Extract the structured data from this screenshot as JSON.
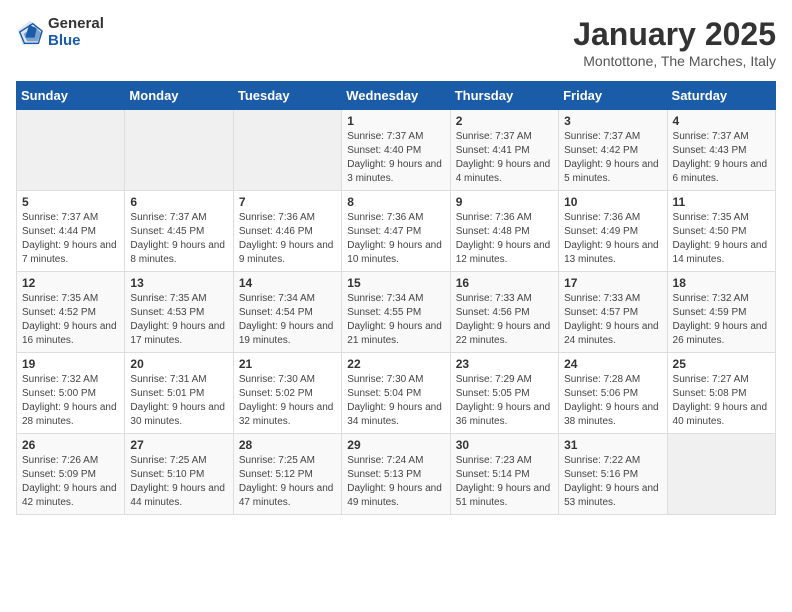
{
  "header": {
    "logo_general": "General",
    "logo_blue": "Blue",
    "month_title": "January 2025",
    "subtitle": "Montottone, The Marches, Italy"
  },
  "weekdays": [
    "Sunday",
    "Monday",
    "Tuesday",
    "Wednesday",
    "Thursday",
    "Friday",
    "Saturday"
  ],
  "weeks": [
    [
      {
        "day": "",
        "info": ""
      },
      {
        "day": "",
        "info": ""
      },
      {
        "day": "",
        "info": ""
      },
      {
        "day": "1",
        "info": "Sunrise: 7:37 AM\nSunset: 4:40 PM\nDaylight: 9 hours and 3 minutes."
      },
      {
        "day": "2",
        "info": "Sunrise: 7:37 AM\nSunset: 4:41 PM\nDaylight: 9 hours and 4 minutes."
      },
      {
        "day": "3",
        "info": "Sunrise: 7:37 AM\nSunset: 4:42 PM\nDaylight: 9 hours and 5 minutes."
      },
      {
        "day": "4",
        "info": "Sunrise: 7:37 AM\nSunset: 4:43 PM\nDaylight: 9 hours and 6 minutes."
      }
    ],
    [
      {
        "day": "5",
        "info": "Sunrise: 7:37 AM\nSunset: 4:44 PM\nDaylight: 9 hours and 7 minutes."
      },
      {
        "day": "6",
        "info": "Sunrise: 7:37 AM\nSunset: 4:45 PM\nDaylight: 9 hours and 8 minutes."
      },
      {
        "day": "7",
        "info": "Sunrise: 7:36 AM\nSunset: 4:46 PM\nDaylight: 9 hours and 9 minutes."
      },
      {
        "day": "8",
        "info": "Sunrise: 7:36 AM\nSunset: 4:47 PM\nDaylight: 9 hours and 10 minutes."
      },
      {
        "day": "9",
        "info": "Sunrise: 7:36 AM\nSunset: 4:48 PM\nDaylight: 9 hours and 12 minutes."
      },
      {
        "day": "10",
        "info": "Sunrise: 7:36 AM\nSunset: 4:49 PM\nDaylight: 9 hours and 13 minutes."
      },
      {
        "day": "11",
        "info": "Sunrise: 7:35 AM\nSunset: 4:50 PM\nDaylight: 9 hours and 14 minutes."
      }
    ],
    [
      {
        "day": "12",
        "info": "Sunrise: 7:35 AM\nSunset: 4:52 PM\nDaylight: 9 hours and 16 minutes."
      },
      {
        "day": "13",
        "info": "Sunrise: 7:35 AM\nSunset: 4:53 PM\nDaylight: 9 hours and 17 minutes."
      },
      {
        "day": "14",
        "info": "Sunrise: 7:34 AM\nSunset: 4:54 PM\nDaylight: 9 hours and 19 minutes."
      },
      {
        "day": "15",
        "info": "Sunrise: 7:34 AM\nSunset: 4:55 PM\nDaylight: 9 hours and 21 minutes."
      },
      {
        "day": "16",
        "info": "Sunrise: 7:33 AM\nSunset: 4:56 PM\nDaylight: 9 hours and 22 minutes."
      },
      {
        "day": "17",
        "info": "Sunrise: 7:33 AM\nSunset: 4:57 PM\nDaylight: 9 hours and 24 minutes."
      },
      {
        "day": "18",
        "info": "Sunrise: 7:32 AM\nSunset: 4:59 PM\nDaylight: 9 hours and 26 minutes."
      }
    ],
    [
      {
        "day": "19",
        "info": "Sunrise: 7:32 AM\nSunset: 5:00 PM\nDaylight: 9 hours and 28 minutes."
      },
      {
        "day": "20",
        "info": "Sunrise: 7:31 AM\nSunset: 5:01 PM\nDaylight: 9 hours and 30 minutes."
      },
      {
        "day": "21",
        "info": "Sunrise: 7:30 AM\nSunset: 5:02 PM\nDaylight: 9 hours and 32 minutes."
      },
      {
        "day": "22",
        "info": "Sunrise: 7:30 AM\nSunset: 5:04 PM\nDaylight: 9 hours and 34 minutes."
      },
      {
        "day": "23",
        "info": "Sunrise: 7:29 AM\nSunset: 5:05 PM\nDaylight: 9 hours and 36 minutes."
      },
      {
        "day": "24",
        "info": "Sunrise: 7:28 AM\nSunset: 5:06 PM\nDaylight: 9 hours and 38 minutes."
      },
      {
        "day": "25",
        "info": "Sunrise: 7:27 AM\nSunset: 5:08 PM\nDaylight: 9 hours and 40 minutes."
      }
    ],
    [
      {
        "day": "26",
        "info": "Sunrise: 7:26 AM\nSunset: 5:09 PM\nDaylight: 9 hours and 42 minutes."
      },
      {
        "day": "27",
        "info": "Sunrise: 7:25 AM\nSunset: 5:10 PM\nDaylight: 9 hours and 44 minutes."
      },
      {
        "day": "28",
        "info": "Sunrise: 7:25 AM\nSunset: 5:12 PM\nDaylight: 9 hours and 47 minutes."
      },
      {
        "day": "29",
        "info": "Sunrise: 7:24 AM\nSunset: 5:13 PM\nDaylight: 9 hours and 49 minutes."
      },
      {
        "day": "30",
        "info": "Sunrise: 7:23 AM\nSunset: 5:14 PM\nDaylight: 9 hours and 51 minutes."
      },
      {
        "day": "31",
        "info": "Sunrise: 7:22 AM\nSunset: 5:16 PM\nDaylight: 9 hours and 53 minutes."
      },
      {
        "day": "",
        "info": ""
      }
    ]
  ]
}
